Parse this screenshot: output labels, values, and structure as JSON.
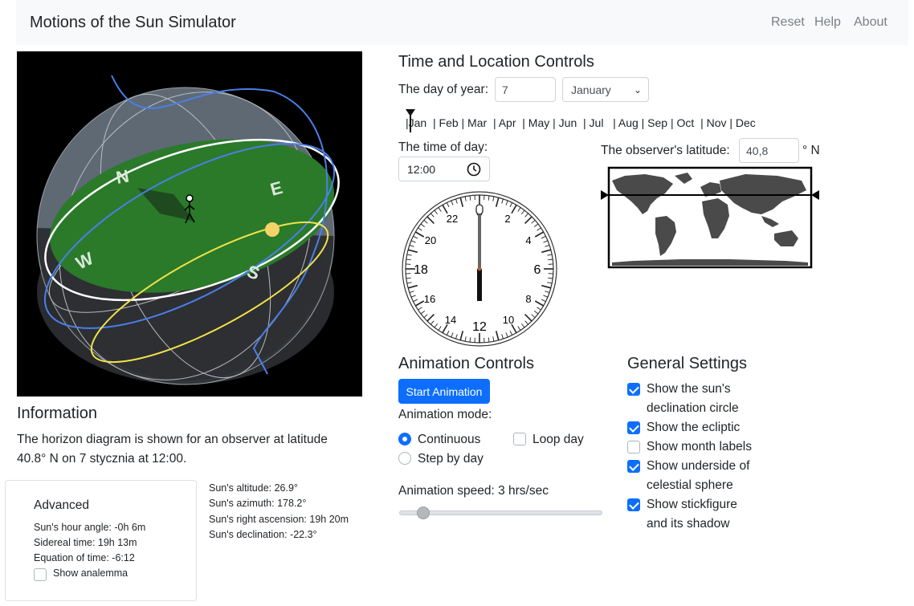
{
  "nav": {
    "brand": "Motions of the Sun Simulator",
    "links": [
      "Reset",
      "Help",
      "About"
    ]
  },
  "sphere": {
    "directions": [
      "N",
      "E",
      "S",
      "W"
    ]
  },
  "time_location": {
    "title": "Time and Location Controls",
    "day_label": "The day of year:",
    "day_value": "7",
    "month_selected": "January",
    "months_row": "|Jan  | Feb | Mar  | Apr  | May | Jun  | Jul   | Aug | Sep | Oct  | Nov | Dec",
    "time_label": "The time of day:",
    "time_value": "12:00",
    "latitude_label": "The observer's latitude:",
    "latitude_value": "40,8",
    "latitude_unit": "° N"
  },
  "clock": {
    "numbers": [
      "22",
      "0",
      "2",
      "20",
      "4",
      "18",
      "6",
      "16",
      "8",
      "14",
      "12",
      "10"
    ],
    "time_fraction": 0.5
  },
  "information": {
    "title": "Information",
    "text": "The horizon diagram is shown for an observer at latitude 40.8° N on 7 stycznia at 12:00."
  },
  "advanced": {
    "title": "Advanced",
    "hour_angle": "Sun's hour angle: -0h 6m",
    "sidereal": "Sidereal time: 19h 13m",
    "equation": "Equation of time: -6:12",
    "show_analemma": "Show analemma"
  },
  "sun_info": {
    "altitude": "Sun's altitude: 26.9°",
    "azimuth": "Sun's azimuth: 178.2°",
    "ra": "Sun's right ascension: 19h 20m",
    "declination": "Sun's declination: -22.3°"
  },
  "animation": {
    "title": "Animation Controls",
    "start_button": "Start Animation",
    "mode_label": "Animation mode:",
    "continuous": "Continuous",
    "step": "Step by day",
    "loop": "Loop day",
    "speed_label": "Animation speed: 3 hrs/sec",
    "speed_value": 3
  },
  "settings": {
    "title": "General Settings",
    "items": [
      {
        "line1": "Show the sun's",
        "line2": "declination circle",
        "checked": true
      },
      {
        "line1": "Show the ecliptic",
        "line2": "",
        "checked": true
      },
      {
        "line1": "Show month labels",
        "line2": "",
        "checked": false
      },
      {
        "line1": "Show underside of",
        "line2": "celestial sphere",
        "checked": true
      },
      {
        "line1": "Show stickfigure",
        "line2": "and its shadow",
        "checked": true
      }
    ]
  },
  "colors": {
    "accent": "#0d6efd",
    "horizon": "#2a7a2a",
    "ecliptic": "#4a7fe8",
    "sun_path": "#f2e24a"
  }
}
